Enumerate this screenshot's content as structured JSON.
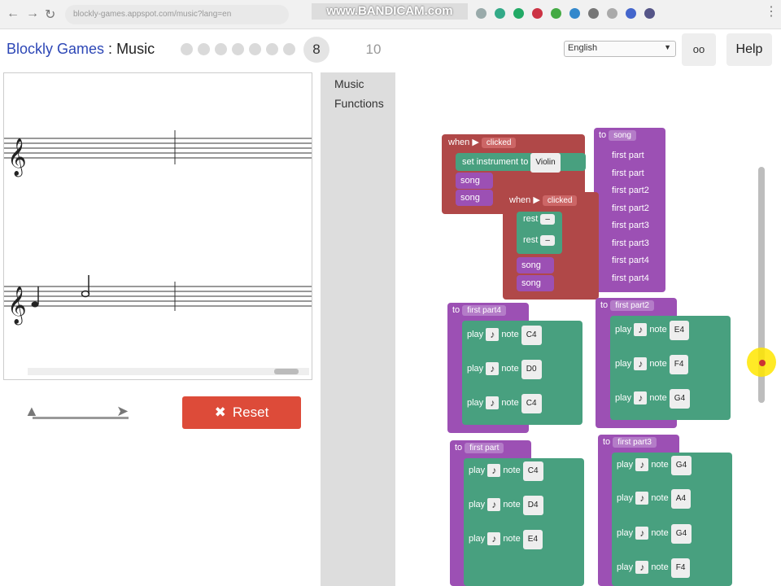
{
  "browser": {
    "url": "blockly-games.appspot.com/music?lang=en",
    "watermark": "www.BANDICAM.com"
  },
  "header": {
    "app": "Blockly Games",
    "sep": " : ",
    "page": "Music",
    "level_current": "8",
    "level_max": "10",
    "language": "English",
    "link_icon": "oo",
    "help": "Help"
  },
  "controls": {
    "reset": "Reset"
  },
  "toolbox": {
    "categories": [
      "Music",
      "Functions"
    ]
  },
  "blocks": {
    "when1": {
      "label": "when",
      "clicked": "clicked",
      "set_instr": "set instrument to",
      "instr": "Violin",
      "song1": "song",
      "song2": "song"
    },
    "when2": {
      "label": "when",
      "clicked": "clicked",
      "rest1": "rest",
      "rest2": "rest",
      "song1": "song",
      "song2": "song"
    },
    "song_def": {
      "to": "to",
      "name": "song",
      "calls": [
        "first part",
        "first part",
        "first part2",
        "first part2",
        "first part3",
        "first part3",
        "first part4",
        "first part4"
      ]
    },
    "fp4": {
      "to": "to",
      "name": "first part4",
      "play": "play",
      "note": "note",
      "notes": [
        "C4",
        "D0",
        "C4"
      ]
    },
    "fp2": {
      "to": "to",
      "name": "first part2",
      "play": "play",
      "note": "note",
      "notes": [
        "E4",
        "F4",
        "G4"
      ]
    },
    "fp1": {
      "to": "to",
      "name": "first part",
      "play": "play",
      "note": "note",
      "notes": [
        "C4",
        "D4",
        "E4"
      ]
    },
    "fp3": {
      "to": "to",
      "name": "first part3",
      "play": "play",
      "note": "note",
      "notes": [
        "G4",
        "A4",
        "G4",
        "F4"
      ]
    }
  },
  "colors": {
    "event": "#b04848",
    "function": "#9c50b4",
    "music": "#48a07f",
    "reset": "#dd4b39"
  }
}
